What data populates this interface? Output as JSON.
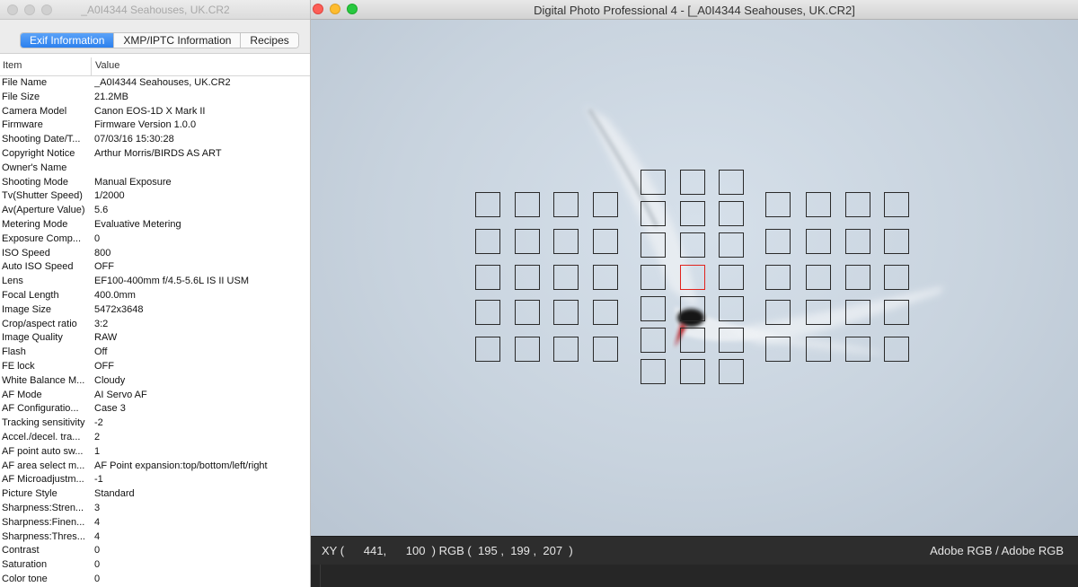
{
  "info_window": {
    "title": "_A0I4344 Seahouses, UK.CR2",
    "tabs": [
      {
        "label": "Exif Information",
        "active": true
      },
      {
        "label": "XMP/IPTC Information",
        "active": false
      },
      {
        "label": "Recipes",
        "active": false
      }
    ],
    "columns": {
      "item": "Item",
      "value": "Value"
    },
    "rows": [
      {
        "item": "File Name",
        "value": "_A0I4344 Seahouses, UK.CR2"
      },
      {
        "item": "File Size",
        "value": "21.2MB"
      },
      {
        "item": "Camera Model",
        "value": "Canon EOS-1D X Mark II"
      },
      {
        "item": "Firmware",
        "value": "Firmware Version 1.0.0"
      },
      {
        "item": "Shooting Date/T...",
        "value": "07/03/16 15:30:28"
      },
      {
        "item": "Copyright Notice",
        "value": "Arthur Morris/BIRDS AS ART"
      },
      {
        "item": "Owner's Name",
        "value": ""
      },
      {
        "item": "Shooting Mode",
        "value": "Manual Exposure"
      },
      {
        "item": "Tv(Shutter Speed)",
        "value": "1/2000"
      },
      {
        "item": "Av(Aperture Value)",
        "value": "5.6"
      },
      {
        "item": "Metering Mode",
        "value": "Evaluative Metering"
      },
      {
        "item": "Exposure Comp...",
        "value": "0"
      },
      {
        "item": "ISO Speed",
        "value": "800"
      },
      {
        "item": "Auto ISO Speed",
        "value": "OFF"
      },
      {
        "item": "Lens",
        "value": "EF100-400mm f/4.5-5.6L IS II USM"
      },
      {
        "item": "Focal Length",
        "value": "400.0mm"
      },
      {
        "item": "Image Size",
        "value": "5472x3648"
      },
      {
        "item": "Crop/aspect ratio",
        "value": "3:2"
      },
      {
        "item": "Image Quality",
        "value": "RAW"
      },
      {
        "item": "Flash",
        "value": "Off"
      },
      {
        "item": "FE lock",
        "value": "OFF"
      },
      {
        "item": "White Balance M...",
        "value": "Cloudy"
      },
      {
        "item": "AF Mode",
        "value": "AI Servo AF"
      },
      {
        "item": "AF Configuratio...",
        "value": "Case 3"
      },
      {
        "item": "Tracking sensitivity",
        "value": "-2"
      },
      {
        "item": "Accel./decel. tra...",
        "value": "2"
      },
      {
        "item": "AF point auto sw...",
        "value": "1"
      },
      {
        "item": "AF area select m...",
        "value": "AF Point expansion:top/bottom/left/right"
      },
      {
        "item": "AF Microadjustm...",
        "value": "-1"
      },
      {
        "item": "Picture Style",
        "value": "Standard"
      },
      {
        "item": "Sharpness:Stren...",
        "value": "3"
      },
      {
        "item": "Sharpness:Finen...",
        "value": "4"
      },
      {
        "item": "Sharpness:Thres...",
        "value": "4"
      },
      {
        "item": "Contrast",
        "value": "0"
      },
      {
        "item": "Saturation",
        "value": "0"
      },
      {
        "item": "Color tone",
        "value": "0"
      }
    ]
  },
  "main_window": {
    "title": "Digital Photo Professional 4 - [_A0I4344 Seahouses, UK.CR2]",
    "colors": {
      "close": "#fd5f57",
      "minimize": "#febc2e",
      "zoom": "#28c840",
      "af_selected": "#e0231d"
    },
    "af_points": {
      "selected": "center"
    },
    "status": {
      "xy_label": "XY (",
      "x": "441",
      "comma": ",",
      "y": "100",
      "xy_close": ")",
      "rgb_label": "RGB (",
      "r": "195",
      "g": "199",
      "b": "207",
      "rgb_close": ")",
      "color_space": "Adobe RGB / Adobe RGB"
    }
  }
}
